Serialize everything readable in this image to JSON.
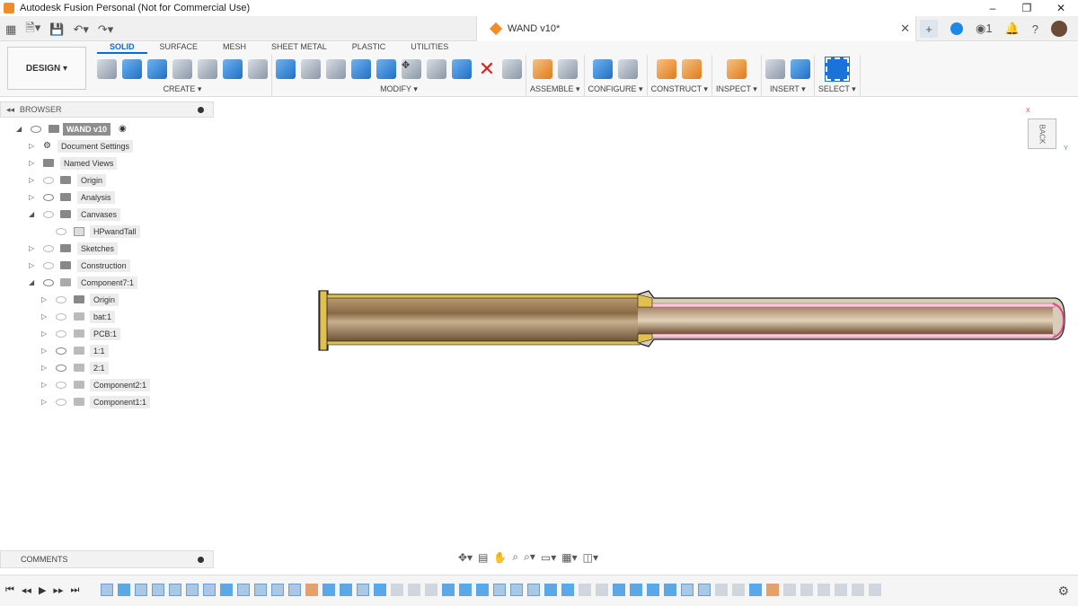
{
  "window": {
    "title": "Autodesk Fusion Personal (Not for Commercial Use)",
    "controls": [
      "–",
      "❐",
      "✕"
    ]
  },
  "quick_access": {
    "icons": [
      "grid-icon",
      "file-icon",
      "save-icon",
      "undo-icon",
      "redo-icon"
    ]
  },
  "document_tab": {
    "label": "WAND v10*",
    "close": "✕"
  },
  "tabbar_right": {
    "plus": "+",
    "jobs_count": "1",
    "help": "?"
  },
  "workspace": {
    "design_label": "DESIGN ▾",
    "tabs": [
      "SOLID",
      "SURFACE",
      "MESH",
      "SHEET METAL",
      "PLASTIC",
      "UTILITIES"
    ],
    "active_tab": "SOLID"
  },
  "toolbar_groups": [
    {
      "label": "CREATE ▾"
    },
    {
      "label": "MODIFY ▾"
    },
    {
      "label": "ASSEMBLE ▾"
    },
    {
      "label": "CONFIGURE ▾"
    },
    {
      "label": "CONSTRUCT ▾"
    },
    {
      "label": "INSPECT ▾"
    },
    {
      "label": "INSERT ▾"
    },
    {
      "label": "SELECT ▾"
    }
  ],
  "browser": {
    "header": "BROWSER",
    "root": "WAND v10",
    "items": [
      {
        "label": "Document Settings",
        "depth": 1
      },
      {
        "label": "Named Views",
        "depth": 1
      },
      {
        "label": "Origin",
        "depth": 1
      },
      {
        "label": "Analysis",
        "depth": 1
      },
      {
        "label": "Canvases",
        "depth": 1
      },
      {
        "label": "HPwandTall",
        "depth": 2
      },
      {
        "label": "Sketches",
        "depth": 1
      },
      {
        "label": "Construction",
        "depth": 1
      },
      {
        "label": "Component7:1",
        "depth": 1
      },
      {
        "label": "Origin",
        "depth": 2
      },
      {
        "label": "bat:1",
        "depth": 2
      },
      {
        "label": "PCB:1",
        "depth": 2
      },
      {
        "label": "1:1",
        "depth": 2
      },
      {
        "label": "2:1",
        "depth": 2
      },
      {
        "label": "Component2:1",
        "depth": 2
      },
      {
        "label": "Component1:1",
        "depth": 2
      }
    ]
  },
  "comments": {
    "label": "COMMENTS"
  },
  "viewcube": {
    "face": "BACK",
    "x_axis": "X",
    "y_axis": "Y"
  },
  "colors": {
    "accent": "#0b69d8",
    "brand": "#f28c28",
    "wand_outline": "#1a1a1a",
    "wand_yellow": "#e0c050",
    "wand_pink": "#d84a8a"
  }
}
